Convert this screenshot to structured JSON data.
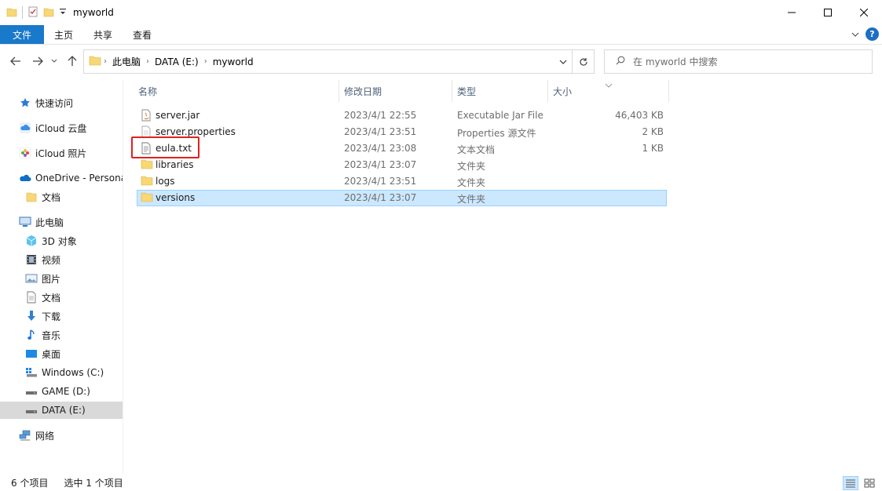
{
  "window": {
    "title": "myworld"
  },
  "ribbon": {
    "file": "文件",
    "tabs": [
      "主页",
      "共享",
      "查看"
    ]
  },
  "nav": {
    "crumbs": [
      "此电脑",
      "DATA (E:)",
      "myworld"
    ],
    "search_placeholder": "在 myworld 中搜索"
  },
  "sidebar": {
    "quick_access": "快速访问",
    "icloud_drive": "iCloud 云盘",
    "icloud_photos": "iCloud 照片",
    "onedrive": "OneDrive - Personal",
    "onedrive_docs": "文档",
    "this_pc": "此电脑",
    "objects3d": "3D 对象",
    "videos": "视频",
    "pictures": "图片",
    "documents": "文档",
    "downloads": "下载",
    "music": "音乐",
    "desktop": "桌面",
    "drive_c": "Windows (C:)",
    "drive_d": "GAME (D:)",
    "drive_e": "DATA (E:)",
    "network": "网络"
  },
  "columns": {
    "name": "名称",
    "modified": "修改日期",
    "type": "类型",
    "size": "大小"
  },
  "files": [
    {
      "name": "server.jar",
      "modified": "2023/4/1 22:55",
      "type": "Executable Jar File",
      "size": "46,403 KB",
      "icon": "jar-file-icon"
    },
    {
      "name": "server.properties",
      "modified": "2023/4/1 23:51",
      "type": "Properties 源文件",
      "size": "2 KB",
      "icon": "properties-file-icon"
    },
    {
      "name": "eula.txt",
      "modified": "2023/4/1 23:08",
      "type": "文本文档",
      "size": "1 KB",
      "icon": "text-file-icon"
    },
    {
      "name": "libraries",
      "modified": "2023/4/1 23:07",
      "type": "文件夹",
      "size": "",
      "icon": "folder-icon"
    },
    {
      "name": "logs",
      "modified": "2023/4/1 23:51",
      "type": "文件夹",
      "size": "",
      "icon": "folder-icon"
    },
    {
      "name": "versions",
      "modified": "2023/4/1 23:07",
      "type": "文件夹",
      "size": "",
      "icon": "folder-icon",
      "selected": true
    }
  ],
  "status": {
    "count": "6 个项目",
    "selected": "选中 1 个项目"
  },
  "colors": {
    "accent": "#1979ca",
    "selection": "#cce8ff",
    "highlight": "#e0211d",
    "folder": "#f8d775"
  }
}
